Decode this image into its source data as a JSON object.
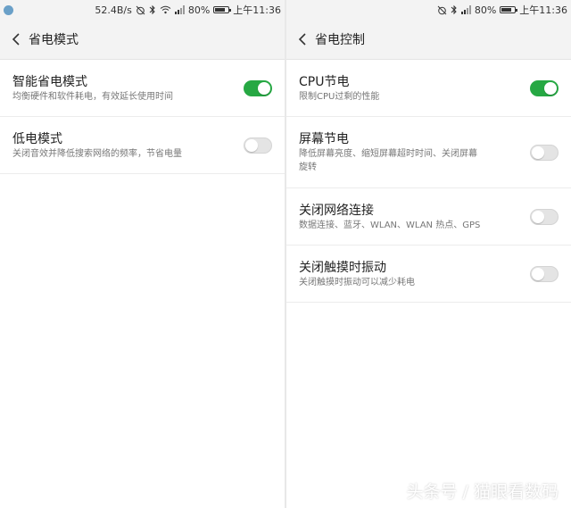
{
  "left": {
    "status": {
      "speed": "52.4B/s",
      "battery": "80%",
      "time": "上午11:36",
      "battery_level": 0.8
    },
    "header": {
      "title": "省电模式"
    },
    "rows": [
      {
        "title": "智能省电模式",
        "desc": "均衡硬件和软件耗电，有效延长使用时间",
        "enabled": true
      },
      {
        "title": "低电模式",
        "desc": "关闭音效并降低搜索网络的频率，节省电量",
        "enabled": false
      }
    ]
  },
  "right": {
    "status": {
      "battery": "80%",
      "time": "上午11:36",
      "battery_level": 0.8
    },
    "header": {
      "title": "省电控制"
    },
    "rows": [
      {
        "title": "CPU节电",
        "desc": "限制CPU过剩的性能",
        "enabled": true
      },
      {
        "title": "屏幕节电",
        "desc_line1": "降低屏幕亮度、缩短屏幕超时时间、关闭屏幕",
        "desc_line2": "旋转",
        "enabled": false
      },
      {
        "title": "关闭网络连接",
        "desc": "数据连接、蓝牙、WLAN、WLAN 热点、GPS",
        "enabled": false
      },
      {
        "title": "关闭触摸时振动",
        "desc": "关闭触摸时振动可以减少耗电",
        "enabled": false
      }
    ]
  },
  "watermark": "头条号 / 猫眼看数码",
  "colors": {
    "toggle_on": "#26a843",
    "toggle_off": "#e4e4e4",
    "bar_bg": "#f3f3f3"
  },
  "icons": [
    "back-chevron-icon",
    "alarm-off-icon",
    "bluetooth-icon",
    "wifi-icon",
    "signal-icon",
    "battery-icon"
  ]
}
